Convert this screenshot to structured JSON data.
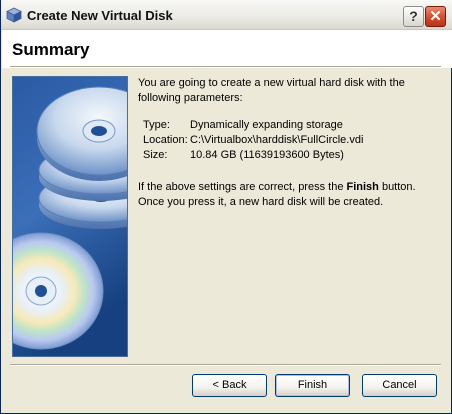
{
  "window": {
    "title": "Create New Virtual Disk",
    "help_label": "?",
    "close_label": "✕"
  },
  "header": {
    "title": "Summary"
  },
  "content": {
    "intro": "You are going to create a new virtual hard disk with the following parameters:",
    "params": [
      {
        "label": "Type:",
        "value": "Dynamically expanding storage"
      },
      {
        "label": "Location:",
        "value": "C:\\Virtualbox\\harddisk\\FullCircle.vdi"
      },
      {
        "label": "Size:",
        "value": "10.84 GB (11639193600 Bytes)"
      }
    ],
    "confirm_pre": "If the above settings are correct, press the ",
    "confirm_bold": "Finish",
    "confirm_post": " button. Once you press it, a new hard disk will be created."
  },
  "buttons": {
    "back": "< Back",
    "finish": "Finish",
    "cancel": "Cancel"
  },
  "colors": {
    "title_accent": "#0a246a",
    "close_red": "#d4502e",
    "sidebar_blue": "#1f4f95"
  }
}
